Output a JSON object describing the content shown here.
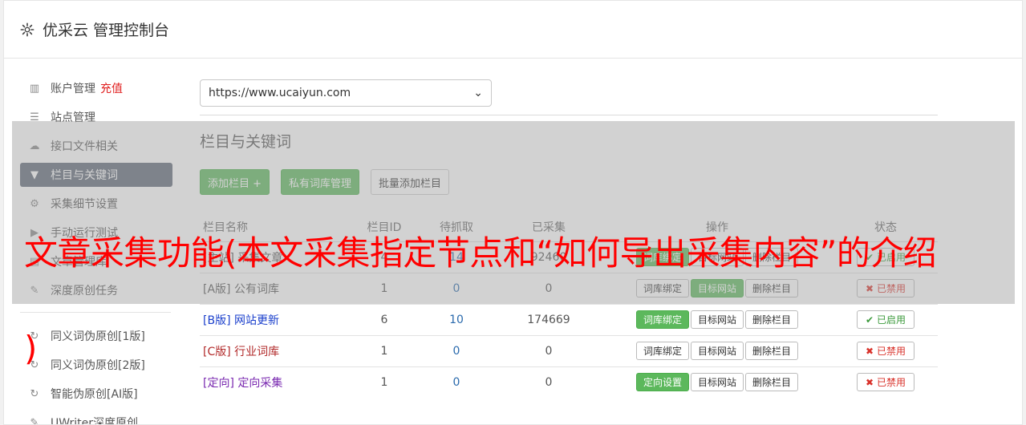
{
  "header": {
    "title": "优采云 管理控制台",
    "icon": "gear-icon"
  },
  "sidebar": {
    "items": [
      {
        "label": "账户管理",
        "extra": "充值",
        "icon": "bar-chart-icon"
      },
      {
        "label": "站点管理",
        "icon": "server-icon"
      },
      {
        "label": "接口文件相关",
        "icon": "cloud-upload-icon"
      },
      {
        "label": "栏目与关键词",
        "icon": "filter-icon",
        "active": true
      },
      {
        "label": "采集细节设置",
        "icon": "gears-icon"
      },
      {
        "label": "手动运行测试",
        "icon": "play-icon"
      },
      {
        "label": "文章管理库",
        "icon": "book-icon"
      },
      {
        "label": "深度原创任务",
        "icon": "edit-icon"
      }
    ],
    "items2": [
      {
        "label": "同义词伪原创[1版]",
        "icon": "refresh-icon"
      },
      {
        "label": "同义词伪原创[2版]",
        "icon": "refresh-icon"
      },
      {
        "label": "智能伪原创[AI版]",
        "icon": "refresh-icon"
      },
      {
        "label": "UWriter深度原创",
        "icon": "edit-icon"
      }
    ]
  },
  "site_select": {
    "value": "https://www.ucaiyun.com"
  },
  "section_title": "栏目与关键词",
  "buttons": {
    "add": "添加栏目 +",
    "private": "私有词库管理",
    "batch": "批量添加栏目"
  },
  "table": {
    "headers": [
      "栏目名称",
      "栏目ID",
      "待抓取",
      "已采集",
      "操作",
      "状态"
    ],
    "rows": [
      {
        "tag": "[主站]",
        "name": "采集文章",
        "id": "4",
        "pending": "14",
        "collected": "92460",
        "op1": "词库绑定",
        "op2": "目标网站",
        "op3": "删除栏目",
        "status": "已启用"
      },
      {
        "tag": "[A版]",
        "name": "公有词库",
        "id": "1",
        "pending": "0",
        "collected": "0",
        "op1": "词库绑定",
        "op2": "目标网站",
        "op3": "删除栏目",
        "status": "已禁用"
      },
      {
        "tag": "[B版]",
        "name": "网站更新",
        "id": "6",
        "pending": "10",
        "collected": "174669",
        "op1": "词库绑定",
        "op2": "目标网站",
        "op3": "删除栏目",
        "status": "已启用"
      },
      {
        "tag": "[C版]",
        "name": "行业词库",
        "id": "1",
        "pending": "0",
        "collected": "0",
        "op1": "词库绑定",
        "op2": "目标网站",
        "op3": "删除栏目",
        "status": "已禁用"
      },
      {
        "tag": "[定向]",
        "name": "定向采集",
        "id": "1",
        "pending": "0",
        "collected": "0",
        "op1": "定向设置",
        "op2": "目标网站",
        "op3": "删除栏目",
        "status": "已禁用"
      }
    ]
  },
  "overlay_caption": "文章采集功能(本文采集指定节点和“如何导出采集内容”的介绍",
  "overlay_paren": ")",
  "colors": {
    "accent": "#5cb85c",
    "active_nav": "#5e6877",
    "caption": "#ff0000"
  }
}
